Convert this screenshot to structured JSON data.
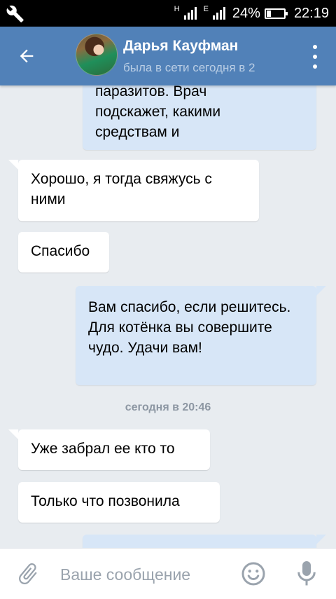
{
  "statusbar": {
    "battery": "24%",
    "battery_level": 0.24,
    "time": "22:19",
    "net1": "H",
    "net1_sim": "1",
    "net2": "E",
    "net2_sim": "2"
  },
  "header": {
    "name": "Дарья Кауфман",
    "status": "была в сети сегодня в 2"
  },
  "messages": [
    {
      "dir": "out",
      "text_lines": [
        "паразитов. Врач",
        "подскажет, какими",
        "средствам и"
      ]
    },
    {
      "dir": "in",
      "text": "Хорошо, я тогда свяжусь с ними"
    },
    {
      "dir": "in",
      "text": "Спасибо"
    },
    {
      "dir": "out",
      "text": "Вам спасибо, если решитесь. Для котёнка вы совершите чудо. Удачи вам!"
    },
    {
      "dir": "in",
      "text": "Уже забрал ее кто то"
    },
    {
      "dir": "in",
      "text": "Только что позвонила"
    }
  ],
  "date_separator": "сегодня в 20:46",
  "composer": {
    "placeholder": "Ваше сообщение"
  },
  "colors": {
    "header": "#5181b8",
    "incoming": "#ffffff",
    "outgoing": "#d7e6f7",
    "background": "#e8ecf0"
  }
}
